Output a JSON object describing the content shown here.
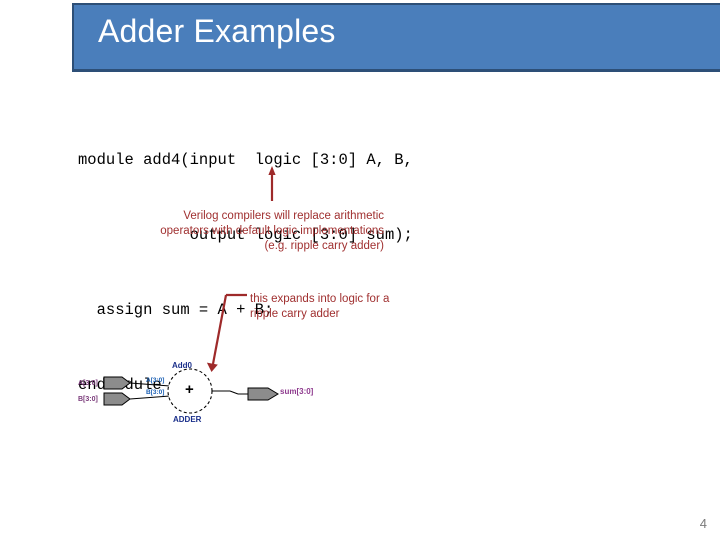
{
  "slide": {
    "title": "Adder Examples",
    "page_number": "4",
    "title_bar_color": "#4a7ebb",
    "title_bar_border_color": "#2d4f77",
    "title_text_color": "#ffffff",
    "annotation_color": "#a03030",
    "page_number_color": "#7b7b7b"
  },
  "code": {
    "lines": [
      "module add4(input  logic [3:0] A, B,",
      "            output logic [3:0] sum);",
      "  assign sum = A + B;",
      "endmodule"
    ]
  },
  "annotations": [
    {
      "name": "compilers-note",
      "lines": [
        "Verilog compilers will replace arithmetic",
        "operators with default logic implementations",
        "(e.g. ripple carry adder)"
      ]
    },
    {
      "name": "expands-note",
      "lines": [
        "this expands into logic for a",
        "ripple carry adder"
      ]
    }
  ],
  "diagram": {
    "instance_label": "Add0",
    "block_type_label": "ADDER",
    "operator_symbol": "+",
    "input_ports": [
      {
        "label": "A[3:0]",
        "wire_label": "A[3:0]"
      },
      {
        "label": "B[3:0]",
        "wire_label": "B[3:0]"
      }
    ],
    "output_port": {
      "label": "sum[3:0]"
    },
    "colors": {
      "port_label": "#7a3a7a",
      "wire_label": "#1a5fb4",
      "instance_label": "#1a2f8a",
      "output_label": "#8e3a8e",
      "port_fill": "#8c8c8c"
    }
  }
}
